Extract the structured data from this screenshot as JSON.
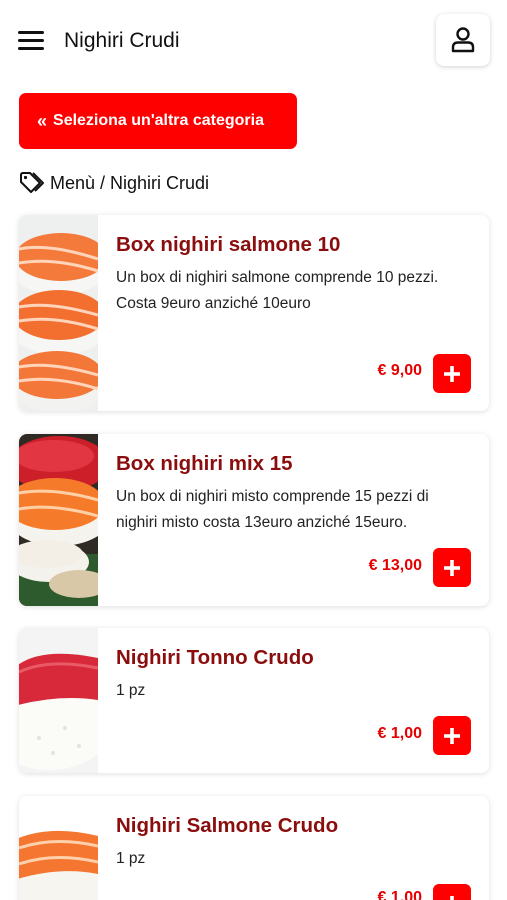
{
  "header": {
    "title": "Nighiri Crudi",
    "menu_icon": "hamburger-icon",
    "user_icon": "user-icon"
  },
  "category_button": {
    "icon": "double-chevron-left-icon",
    "label": "Seleziona un'altra categoria"
  },
  "breadcrumb": {
    "icon": "tag-icon",
    "text": "Menù / Nighiri Crudi"
  },
  "products": [
    {
      "name": "Box nighiri salmone 10",
      "description": [
        "Un box di nighiri salmone comprende 10 pezzi.",
        "Costa 9euro anziché 10euro"
      ],
      "price": "€ 9,00",
      "image": "salmon-nigiri-photo"
    },
    {
      "name": "Box nighiri mix 15",
      "description": [
        "Un box di nighiri misto comprende 15 pezzi di nighiri misto costa 13euro anziché 15euro."
      ],
      "price": "€ 13,00",
      "image": "mixed-nigiri-photo"
    },
    {
      "name": "Nighiri Tonno Crudo",
      "description": [
        "1 pz"
      ],
      "price": "€ 1,00",
      "image": "tuna-nigiri-photo"
    },
    {
      "name": "Nighiri Salmone Crudo",
      "description": [
        "1 pz"
      ],
      "price": "€ 1,00",
      "image": "salmon-nigiri-photo"
    }
  ],
  "colors": {
    "accent": "#ff0000",
    "product_name": "#8b0d0d",
    "price": "#e60000"
  }
}
